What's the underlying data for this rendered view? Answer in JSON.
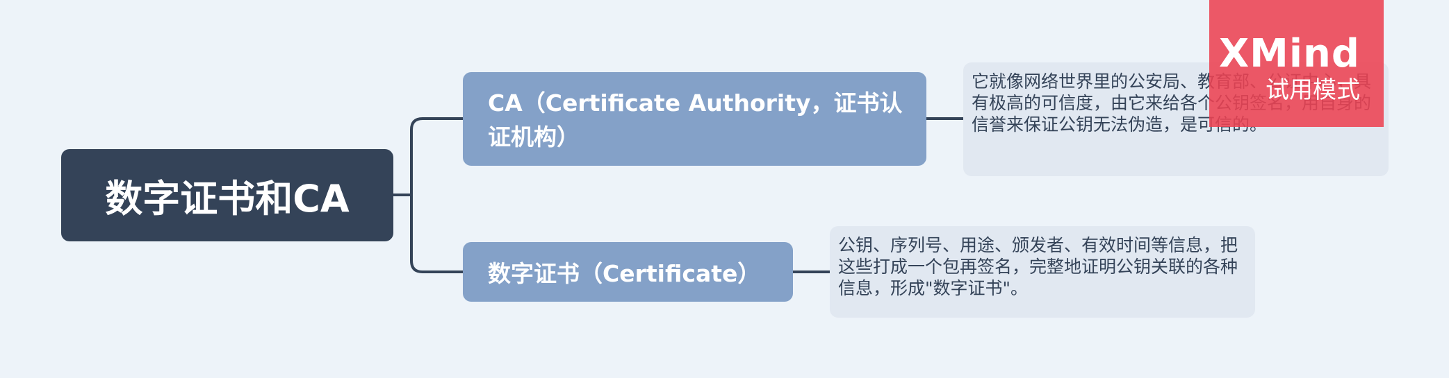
{
  "mindmap": {
    "root": "数字证书和CA",
    "branches": [
      {
        "label": "CA（Certificate Authority，证书认证机构）",
        "note": "它就像网络世界里的公安局、教育部、公证中心，具有极高的可信度，由它来给各个公钥签名，用自身的信誉来保证公钥无法伪造，是可信的。"
      },
      {
        "label": "数字证书（Certificate）",
        "note": "公钥、序列号、用途、颁发者、有效时间等信息，把这些打成一个包再签名，完整地证明公钥关联的各种信息，形成\"数字证书\"。"
      }
    ]
  },
  "watermark": {
    "logo": "XMind",
    "mode": "试用模式"
  },
  "colors": {
    "background": "#edf3f9",
    "root": "#344358",
    "topic": "#84a1c8",
    "note": "#e1e8f1",
    "connector": "#344358",
    "watermark": "#ec4252"
  }
}
